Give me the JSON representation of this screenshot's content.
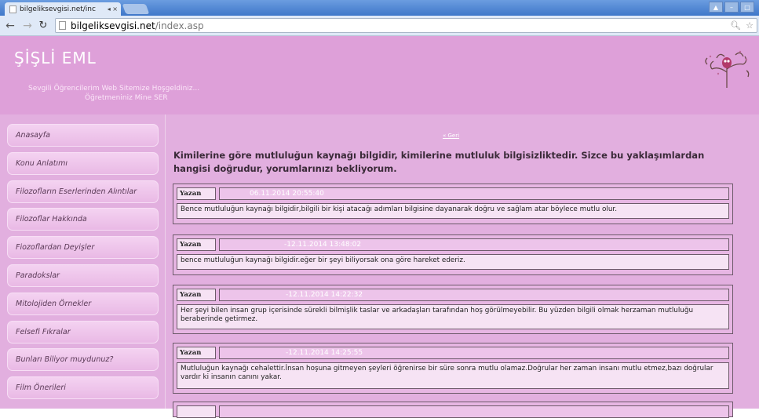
{
  "browser": {
    "tab_title": "bilgeliksevgisi.net/inc",
    "url_host": "bilgeliksevgisi.net",
    "url_path": "/index.asp"
  },
  "header": {
    "site_title": "ŞİŞLİ EML",
    "welcome_line1": "Sevgili Öğrencilerim Web Sitemize Hoşgeldiniz...",
    "welcome_line2": "Öğretmeniniz Mine SER"
  },
  "sidebar": {
    "items": [
      {
        "label": "Anasayfa"
      },
      {
        "label": "Konu Anlatımı"
      },
      {
        "label": "Filozofların Eserlerinden Alıntılar"
      },
      {
        "label": "Filozoflar Hakkında"
      },
      {
        "label": "Fiozoflardan Deyişler"
      },
      {
        "label": "Paradokslar"
      },
      {
        "label": "Mitolojiden Örnekler"
      },
      {
        "label": "Felsefi Fıkralar"
      },
      {
        "label": "Bunları Biliyor muydunuz?"
      },
      {
        "label": "Film Önerileri"
      }
    ]
  },
  "main": {
    "back_link": "« Geri",
    "question": "Kimilerine göre mutluluğun kaynağı bilgidir, kimilerine mutluluk bilgisizliktedir. Sizce bu yaklaşımlardan hangisi doğrudur, yorumlarınızı bekliyorum.",
    "comments": [
      {
        "author_label": "Yazan",
        "date": "06.11.2014 20:55:40",
        "text": "Bence mutluluğun kaynağı bilgidir,bilgili bir kişi atacağı adımları bilgisine dayanarak doğru ve sağlam atar böylece mutlu olur."
      },
      {
        "author_label": "Yazan",
        "date": "-12.11.2014 13:48:02",
        "text": "bence mutluluğun kaynağı bilgidir.eğer bir şeyi biliyorsak ona göre hareket ederiz."
      },
      {
        "author_label": "Yazan",
        "date": "-12.11.2014 14:22:32",
        "text": "Her şeyi bilen insan grup içerisinde sürekli bilmişlik taslar ve arkadaşları tarafından hoş görülmeyebilir. Bu yüzden bilgili olmak herzaman mutluluğu beraberinde getirmez."
      },
      {
        "author_label": "Yazan",
        "date": "-12.11.2014 14:25:55",
        "text": "Mutluluğun kaynağı cehalettir.İnsan hoşuna gitmeyen şeyleri öğrenirse bir süre sonra mutlu olamaz.Doğrular her zaman insanı mutlu etmez,bazı doğrular vardır ki insanın canını yakar."
      },
      {
        "author_label": "",
        "date": "",
        "text": ""
      }
    ]
  }
}
